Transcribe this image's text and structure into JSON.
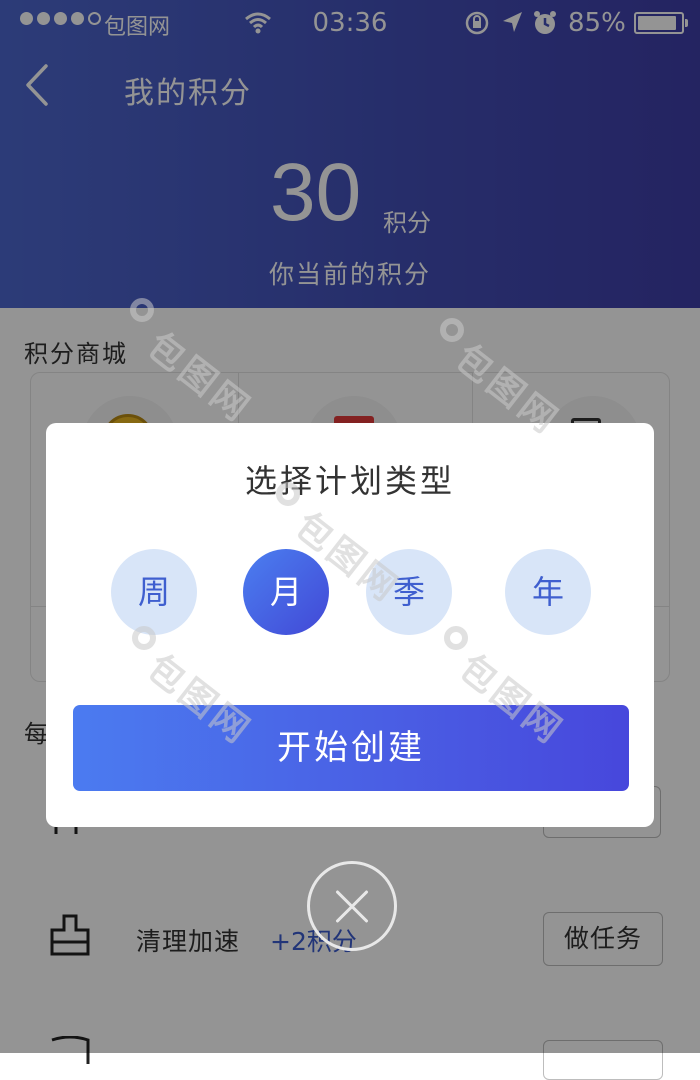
{
  "status_bar": {
    "carrier": "包图网",
    "time": "03:36",
    "battery": "85%"
  },
  "header": {
    "back_icon": "chevron-left-icon",
    "title": "我的积分",
    "points_value": "30",
    "points_unit": "积分",
    "points_caption": "你当前的积分"
  },
  "mall": {
    "title": "积分商城"
  },
  "daily": {
    "title": "每"
  },
  "tasks": [
    {
      "name": "清理加速",
      "points": "+2积分",
      "button": "做任务"
    }
  ],
  "modal": {
    "title": "选择计划类型",
    "options": [
      "周",
      "月",
      "季",
      "年"
    ],
    "selected": "月",
    "start_label": "开始创建"
  },
  "watermark": {
    "text": "包图网"
  },
  "colors": {
    "header_start": "#4d67cf",
    "header_end": "#3f3ea8",
    "accent": "#4a5fe4",
    "option_bg": "#d8e5f8",
    "option_text": "#3f5fcf",
    "points_text": "#3c5ccf"
  }
}
